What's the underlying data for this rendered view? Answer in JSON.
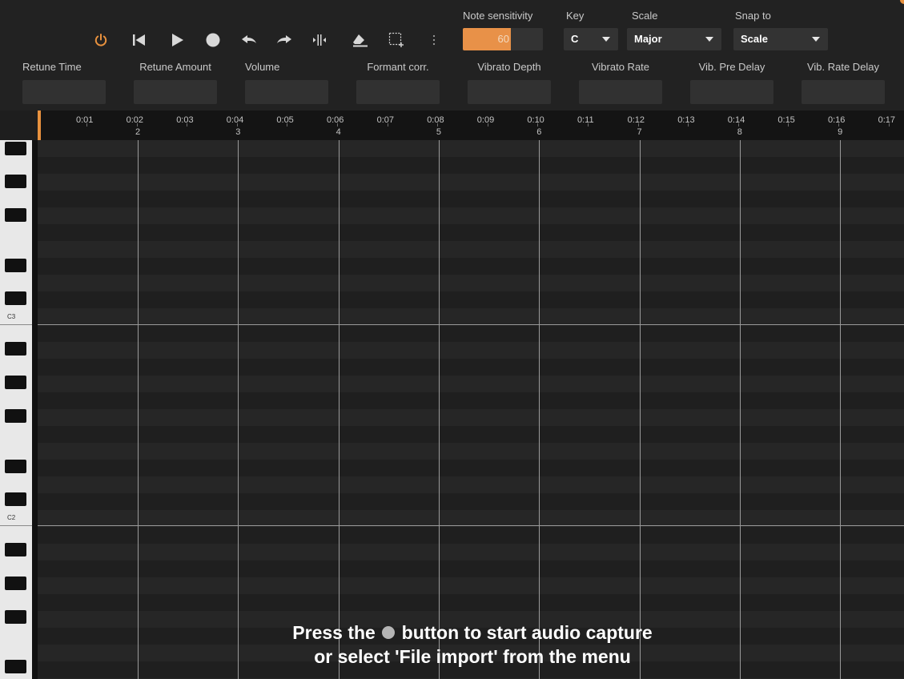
{
  "toolbar": {
    "buttons": [
      {
        "name": "power-icon",
        "active_color": "#e8913e"
      },
      {
        "name": "skip-to-start-icon"
      },
      {
        "name": "play-icon"
      },
      {
        "name": "record-icon"
      },
      {
        "name": "undo-icon"
      },
      {
        "name": "redo-icon"
      },
      {
        "name": "split-icon"
      },
      {
        "name": "eraser-icon"
      },
      {
        "name": "selection-icon"
      },
      {
        "name": "more-vertical-icon"
      }
    ],
    "note_sensitivity": {
      "label": "Note sensitivity",
      "value": "60",
      "fill_fraction": 0.6
    },
    "key": {
      "label": "Key",
      "value": "C"
    },
    "scale": {
      "label": "Scale",
      "value": "Major"
    },
    "snap": {
      "label": "Snap to",
      "value": "Scale"
    }
  },
  "params": [
    {
      "label": "Retune Time"
    },
    {
      "label": "Retune Amount"
    },
    {
      "label": "Volume"
    },
    {
      "label": "Formant corr."
    },
    {
      "label": "Vibrato Depth"
    },
    {
      "label": "Vibrato Rate"
    },
    {
      "label": "Vib. Pre Delay"
    },
    {
      "label": "Vib. Rate Delay"
    }
  ],
  "timeline": {
    "time_labels": [
      "0:01",
      "0:02",
      "0:03",
      "0:04",
      "0:05",
      "0:06",
      "0:07",
      "0:08",
      "0:09",
      "0:10",
      "0:11",
      "0:12",
      "0:13",
      "0:14",
      "0:15",
      "0:16",
      "0:17"
    ],
    "measure_labels": [
      "2",
      "3",
      "4",
      "5",
      "6",
      "7",
      "8",
      "9"
    ]
  },
  "keyboard": {
    "octave_labels": [
      "C3",
      "C2"
    ]
  },
  "colors": {
    "accent": "#e8913e",
    "background": "#1e1e1e"
  },
  "message": {
    "line1_before": "Press the",
    "line1_after": "button to start audio capture",
    "line2": "or select 'File import' from the menu"
  }
}
